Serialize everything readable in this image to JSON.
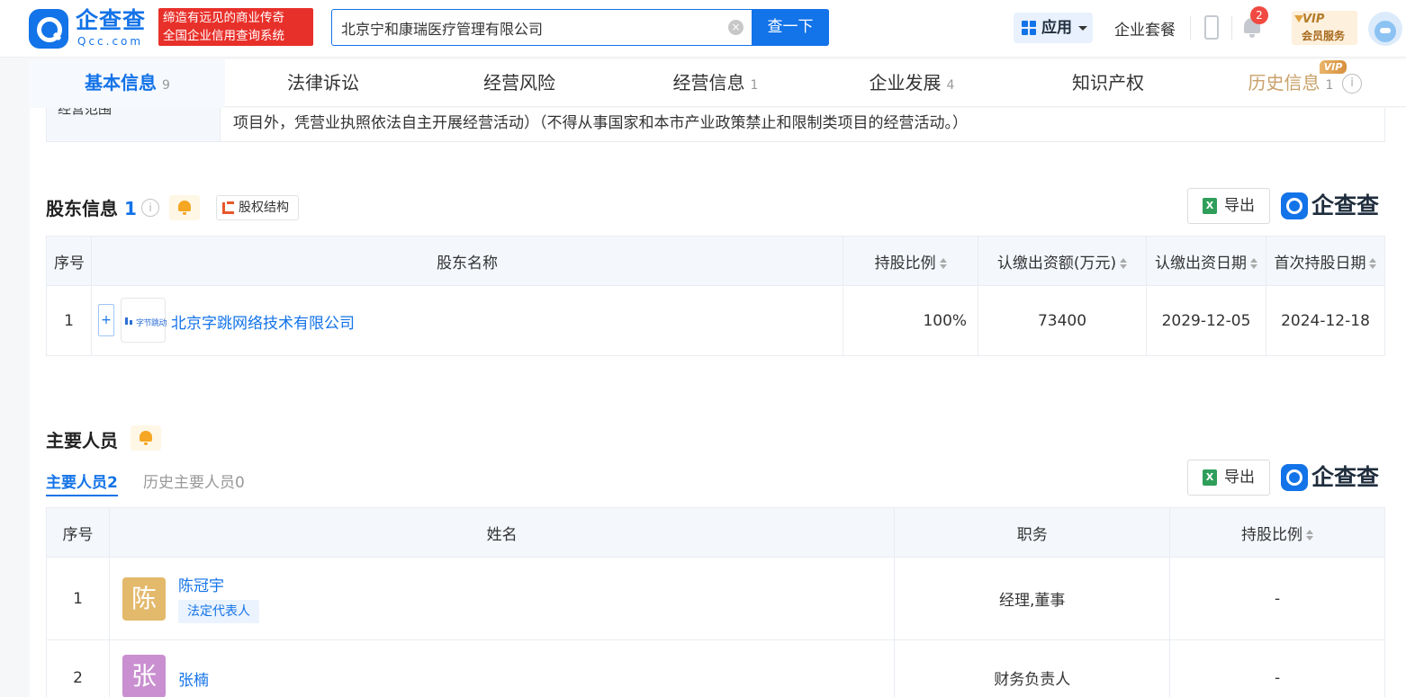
{
  "header": {
    "logo_cn": "企查查",
    "logo_en": "Qcc.com",
    "slogan_line1": "缔造有远见的商业传奇",
    "slogan_line2": "全国企业信用查询系统",
    "search_value": "北京宁和康瑞医疗管理有限公司",
    "search_button": "查一下",
    "app_label": "应用",
    "package_label": "企业套餐",
    "notification_count": "2",
    "vip_top": "VIP",
    "vip_sub": "会员服务"
  },
  "tabs": [
    {
      "label": "基本信息",
      "count": "9"
    },
    {
      "label": "法律诉讼",
      "count": ""
    },
    {
      "label": "经营风险",
      "count": ""
    },
    {
      "label": "经营信息",
      "count": "1"
    },
    {
      "label": "企业发展",
      "count": "4"
    },
    {
      "label": "知识产权",
      "count": ""
    },
    {
      "label": "历史信息",
      "count": "1"
    }
  ],
  "history_vip_tag": "VIP",
  "business_scope": {
    "label": "经营范围",
    "text_tail": "项目外，凭营业执照依法自主开展经营活动）（不得从事国家和本市产业政策禁止和限制类项目的经营活动。）"
  },
  "shareholders": {
    "title": "股东信息",
    "count": "1",
    "structure_button": "股权结构",
    "export_label": "导出",
    "brand": "企查查",
    "columns": {
      "index": "序号",
      "name": "股东名称",
      "ratio": "持股比例",
      "amount": "认缴出资额(万元)",
      "date": "认缴出资日期",
      "first_date": "首次持股日期"
    },
    "rows": [
      {
        "index": "1",
        "name": "北京字跳网络技术有限公司",
        "logo_text": "字节跳动",
        "ratio": "100%",
        "amount": "73400",
        "date": "2029-12-05",
        "first_date": "2024-12-18"
      }
    ]
  },
  "personnel": {
    "title": "主要人员",
    "subtab_current": "主要人员",
    "subtab_current_count": "2",
    "subtab_history": "历史主要人员",
    "subtab_history_count": "0",
    "export_label": "导出",
    "brand": "企查查",
    "columns": {
      "index": "序号",
      "name": "姓名",
      "role": "职务",
      "ratio": "持股比例"
    },
    "rows": [
      {
        "index": "1",
        "avatar_char": "陈",
        "avatar_color": "#e3b96c",
        "name": "陈冠宇",
        "tag": "法定代表人",
        "role": "经理,董事",
        "ratio": "-"
      },
      {
        "index": "2",
        "avatar_char": "张",
        "avatar_color": "#c98fd0",
        "name": "张楠",
        "tag": "",
        "role": "财务负责人",
        "ratio": "-"
      }
    ]
  }
}
